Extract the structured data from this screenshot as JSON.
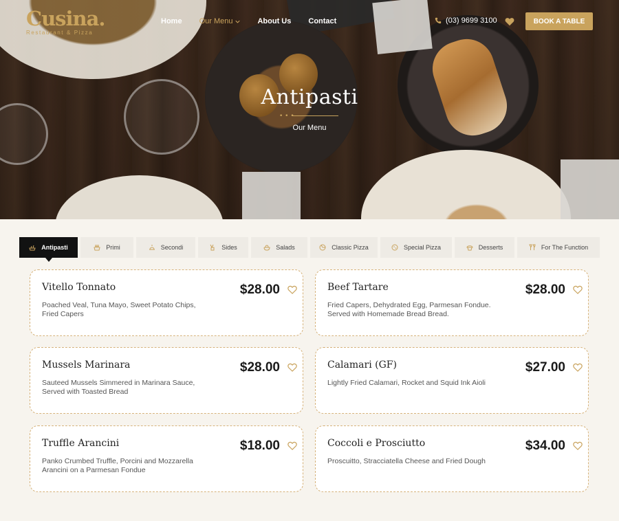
{
  "header": {
    "logo": {
      "name": "Cusina.",
      "tagline": "Restaurant & Pizza"
    },
    "nav": [
      {
        "label": "Home",
        "active": false
      },
      {
        "label": "Our Menu",
        "active": true
      },
      {
        "label": "About Us",
        "active": false
      },
      {
        "label": "Contact",
        "active": false
      }
    ],
    "phone": "(03) 9699 3100",
    "book_button": "BOOK A TABLE"
  },
  "hero": {
    "title": "Antipasti",
    "subtitle": "Our Menu"
  },
  "tabs": [
    {
      "label": "Antipasti",
      "icon": "antipasti-icon",
      "active": true
    },
    {
      "label": "Primi",
      "icon": "primi-icon",
      "active": false
    },
    {
      "label": "Secondi",
      "icon": "secondi-icon",
      "active": false
    },
    {
      "label": "Sides",
      "icon": "sides-icon",
      "active": false
    },
    {
      "label": "Salads",
      "icon": "salads-icon",
      "active": false
    },
    {
      "label": "Classic Pizza",
      "icon": "pizza-icon",
      "active": false
    },
    {
      "label": "Special Pizza",
      "icon": "special-pizza-icon",
      "active": false
    },
    {
      "label": "Desserts",
      "icon": "desserts-icon",
      "active": false
    },
    {
      "label": "For The Function",
      "icon": "function-icon",
      "active": false
    }
  ],
  "menu_items": [
    {
      "name": "Vitello Tonnato",
      "description": "Poached Veal, Tuna Mayo, Sweet Potato Chips, Fried Capers",
      "price": "$28.00"
    },
    {
      "name": "Beef Tartare",
      "description": "Fried Capers, Dehydrated Egg, Parmesan Fondue. Served with Homemade Bread Bread.",
      "price": "$28.00"
    },
    {
      "name": "Mussels Marinara",
      "description": "Sauteed Mussels Simmered in Marinara Sauce, Served with Toasted Bread",
      "price": "$28.00"
    },
    {
      "name": "Calamari (GF)",
      "description": "Lightly Fried Calamari, Rocket and Squid Ink Aioli",
      "price": "$27.00"
    },
    {
      "name": "Truffle Arancini",
      "description": "Panko Crumbed Truffle, Porcini and Mozzarella Arancini on a Parmesan Fondue",
      "price": "$18.00"
    },
    {
      "name": "Coccoli e Prosciutto",
      "description": "Proscuitto, Stracciatella Cheese and Fried Dough",
      "price": "$34.00"
    }
  ],
  "colors": {
    "accent_gold": "#c9a35d",
    "card_border": "#d6b27a",
    "active_tab": "#121212",
    "page_bg": "#f7f4ee"
  }
}
